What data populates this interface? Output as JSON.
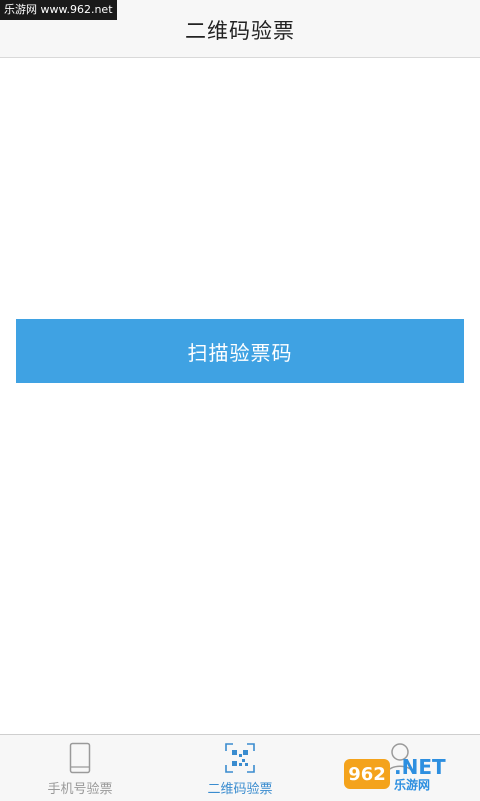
{
  "watermark": {
    "top_text": "乐游网 www.962.net",
    "logo_number": "962",
    "brand_suffix": ".NET",
    "brand_cn": "乐游网"
  },
  "header": {
    "title": "二维码验票"
  },
  "main": {
    "scan_button_label": "扫描验票码"
  },
  "tabs": [
    {
      "label": "手机号验票",
      "icon": "phone-icon",
      "active": false
    },
    {
      "label": "二维码验票",
      "icon": "qr-code-icon",
      "active": true
    },
    {
      "label": "",
      "icon": "user-icon",
      "active": false
    }
  ],
  "colors": {
    "accent": "#3fa2e3",
    "active_tab": "#3a8ccf",
    "inactive_tab": "#9a9a9a",
    "header_bg": "#f7f7f7"
  }
}
